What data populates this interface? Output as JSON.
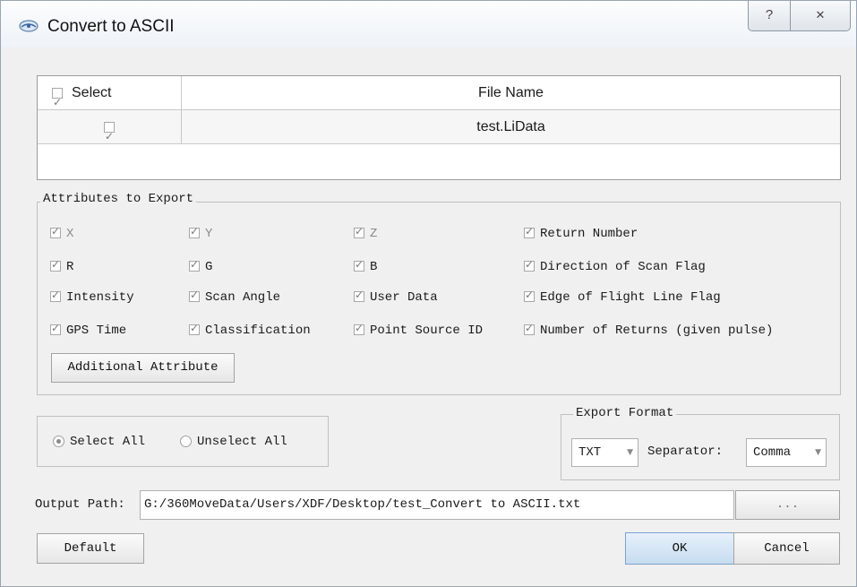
{
  "window": {
    "title": "Convert to ASCII",
    "help_label": "?",
    "close_label": "✕"
  },
  "file_table": {
    "select_header": "Select",
    "file_header": "File Name",
    "rows": [
      {
        "file": "test.LiData",
        "checked": true
      }
    ]
  },
  "attributes": {
    "legend": "Attributes to Export",
    "items": [
      {
        "label": "X",
        "checked": true,
        "enabled": false
      },
      {
        "label": "Y",
        "checked": true,
        "enabled": false
      },
      {
        "label": "Z",
        "checked": true,
        "enabled": false
      },
      {
        "label": "Return Number",
        "checked": true,
        "enabled": true
      },
      {
        "label": "R",
        "checked": true,
        "enabled": true
      },
      {
        "label": "G",
        "checked": true,
        "enabled": true
      },
      {
        "label": "B",
        "checked": true,
        "enabled": true
      },
      {
        "label": "Direction of Scan Flag",
        "checked": true,
        "enabled": true
      },
      {
        "label": "Intensity",
        "checked": true,
        "enabled": true
      },
      {
        "label": "Scan Angle",
        "checked": true,
        "enabled": true
      },
      {
        "label": "User Data",
        "checked": true,
        "enabled": true
      },
      {
        "label": "Edge of Flight Line Flag",
        "checked": true,
        "enabled": true
      },
      {
        "label": "GPS Time",
        "checked": true,
        "enabled": true
      },
      {
        "label": "Classification",
        "checked": true,
        "enabled": true
      },
      {
        "label": "Point Source ID",
        "checked": true,
        "enabled": true
      },
      {
        "label": "Number of Returns (given pulse)",
        "checked": true,
        "enabled": true
      }
    ],
    "additional_button": "Additional Attribute"
  },
  "selection": {
    "select_all": "Select All",
    "unselect_all": "Unselect All",
    "selected": "select_all"
  },
  "export_format": {
    "legend": "Export Format",
    "format_value": "TXT",
    "separator_label": "Separator:",
    "separator_value": "Comma"
  },
  "output": {
    "label": "Output Path:",
    "path": "G:/360MoveData/Users/XDF/Desktop/test_Convert to ASCII.txt",
    "browse_label": "..."
  },
  "buttons": {
    "default": "Default",
    "ok": "OK",
    "cancel": "Cancel"
  }
}
